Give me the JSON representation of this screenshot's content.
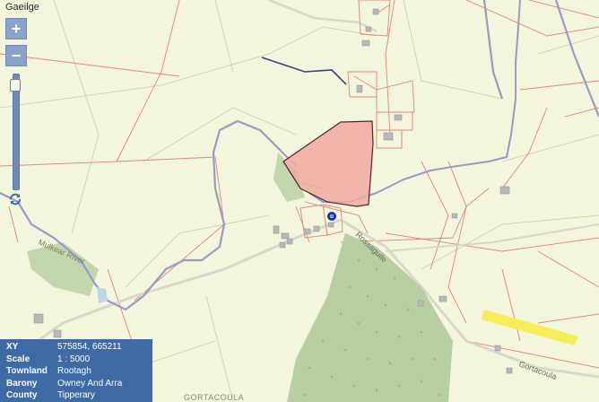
{
  "header": {
    "language_link": "Gaeilge"
  },
  "controls": {
    "zoom_in": "+",
    "zoom_out": "−",
    "zoom_level": 0.04
  },
  "map_labels": {
    "river": "Mulkear River",
    "road": "Rossaguile",
    "townland_right": "Gortacoula",
    "townland_bottom": "GORTACOULA"
  },
  "info": {
    "rows": [
      {
        "label": "XY",
        "value": "575854, 665211"
      },
      {
        "label": "Scale",
        "value": "1 : 5000"
      },
      {
        "label": "Townland",
        "value": "Rootagh"
      },
      {
        "label": "Barony",
        "value": "Owney And Arra"
      },
      {
        "label": "County",
        "value": "Tipperary"
      }
    ]
  },
  "colors": {
    "background": "#f3f5dc",
    "river": "#9a9ac2",
    "boundary": "#d98a7a",
    "selected_parcel": "#f0aaa0",
    "forest": "#b8cfa2",
    "highlight": "#f6ee58",
    "panel": "#3f6aa6"
  }
}
